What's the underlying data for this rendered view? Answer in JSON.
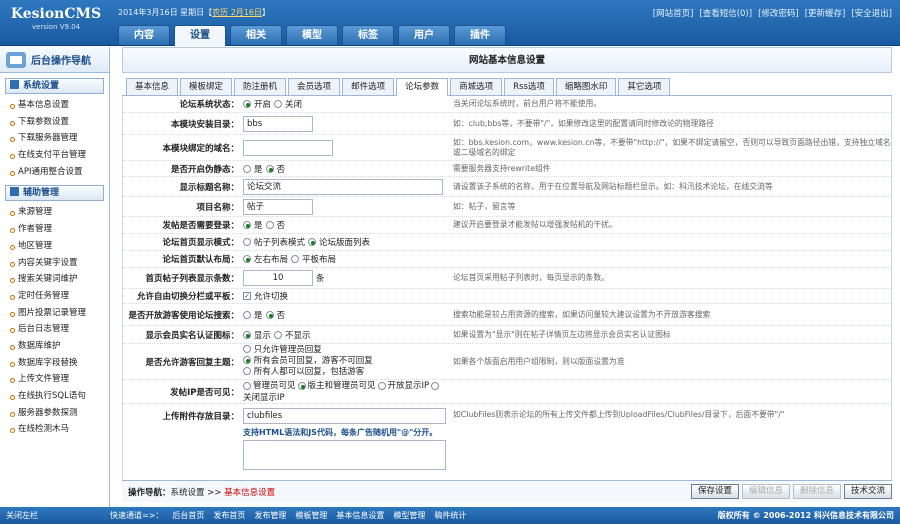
{
  "app": {
    "logo_title": "KesionCMS",
    "logo_version": "version V9.04"
  },
  "header": {
    "date_prefix": "2014年3月16日 星期日【",
    "lunar": "农历 2月16日",
    "date_suffix": "】",
    "links": [
      "[网站首页]",
      "[查看短信(0)]",
      "[修改密码]",
      "[更新缓存]",
      "[安全退出]"
    ],
    "tabs": [
      "内容",
      "设置",
      "相关",
      "模型",
      "标签",
      "用户",
      "插件"
    ],
    "active_tab": 1
  },
  "sidebar": {
    "title": "后台操作导航",
    "group1": "系统设置",
    "group1_items": [
      "基本信息设置",
      "下载参数设置",
      "下载服务器管理",
      "在线支付平台管理",
      "API通用整合设置"
    ],
    "group2": "辅助管理",
    "group2_items": [
      "来源管理",
      "作者管理",
      "地区管理",
      "内容关键字设置",
      "搜索关键词维护",
      "定时任务管理",
      "图片投票记录管理",
      "后台日志管理",
      "数据库维护",
      "数据库字段替换",
      "上传文件管理",
      "在线执行SQL语句",
      "服务器参数探测",
      "在线检测木马"
    ]
  },
  "page": {
    "title": "网站基本信息设置",
    "subtabs": [
      "基本信息",
      "模板绑定",
      "防注册机",
      "会员选项",
      "邮件选项",
      "论坛参数",
      "商城选项",
      "Rss选项",
      "缩略图水印",
      "其它选项"
    ],
    "active_subtab": 5
  },
  "form": {
    "r1": {
      "label": "论坛系统状态：",
      "opt1": "开启",
      "opt2": "关闭",
      "tip": "当关闭论坛系统时，前台用户将不能使用。"
    },
    "r2": {
      "label": "本模块安装目录：",
      "value": "bbs",
      "tip": "如：club,bbs等，不要带\"/\"，如果修改这里的配置请同时修改论的物理路径"
    },
    "r3": {
      "label": "本模块绑定的域名：",
      "value": "",
      "tip": "如：bbs.kesion.com，www.kesion.cn等，不要带\"http://\"，如果不绑定请留空，否则可以导致页面路径出错，支持独立域名或二级域名的绑定"
    },
    "r4": {
      "label": "是否开启伪静态：",
      "opt1": "是",
      "opt2": "否",
      "tip": "需要服务器支持rewrite组件"
    },
    "r5": {
      "label": "显示标题名称：",
      "value": "论坛交流",
      "tip": "请设置该子系统的名称，用于在位置导航及网站标题栏显示。如：科汛技术论坛，在线交流等"
    },
    "r6": {
      "label": "项目名称：",
      "value": "帖子",
      "tip": "如：帖子，留言等"
    },
    "r7": {
      "label": "发帖是否需要登录：",
      "opt1": "是",
      "opt2": "否",
      "tip": "建议开启要登录才能发帖以增强发帖机的干扰。"
    },
    "r8": {
      "label": "论坛首页显示模式：",
      "opt1": "帖子列表模式",
      "opt2": "论坛版面列表",
      "tip": ""
    },
    "r9": {
      "label": "论坛首页默认布局：",
      "opt1": "左右布局",
      "opt2": "平板布局",
      "tip": ""
    },
    "r10": {
      "label": "首页帖子列表显示条数：",
      "value": "10",
      "unit": "条",
      "tip": "论坛首页采用帖子列表时，每页显示的条数。"
    },
    "r11": {
      "label": "允许自由切换分栏或平板：",
      "opt1": "允许切换",
      "tip": ""
    },
    "r12": {
      "label": "是否开放游客使用论坛搜索：",
      "opt1": "是",
      "opt2": "否",
      "tip": "搜索功能是较占用资源的搜索，如果访问量较大建议设置为不开放游客搜索"
    },
    "r13": {
      "label": "显示会员实名认证图标：",
      "opt1": "显示",
      "opt2": "不显示",
      "tip": "如果设置为\"显示\"则在帖子详情页左边将显示会员实名认证图标"
    },
    "r14": {
      "label": "是否允许游客回复主题：",
      "opt1": "只允许管理员回复",
      "opt2": "所有会员可回复，游客不可回复",
      "opt3": "所有人都可以回复，包括游客",
      "tip": "如果各个版面启用用户组限制，则以版面设置为准"
    },
    "r15": {
      "label": "发帖IP是否可见：",
      "opt1": "管理员可见",
      "opt2": "版主和管理员可见",
      "opt3": "开放显示IP",
      "opt4": "关闭显示IP",
      "tip": ""
    },
    "r16": {
      "label": "上传附件存放目录：",
      "value": "clubfiles",
      "note": "支持HTML语法和JS代码，每条广告随机用\"@\"分开。",
      "tip": "如ClubFiles则表示论坛的所有上传文件都上传到UploadFiles/ClubFiles/目录下，后面不要带\"/\""
    }
  },
  "footer": {
    "nav_label": "操作导航：",
    "nav_path": "系统设置 >> ",
    "nav_current": "基本信息设置",
    "buttons": [
      "保存设置",
      "编辑信息",
      "删除信息",
      "技术交流"
    ]
  },
  "bottom": {
    "close_label": "关闭左栏",
    "quick_label": "快速通道=>：",
    "quick_links": [
      "后台首页",
      "发布首页",
      "发布管理",
      "模板管理",
      "基本信息设置",
      "模型管理",
      "稿件统计"
    ],
    "copyright": "版权所有 © 2006-2012 科兴信息技术有限公司"
  }
}
